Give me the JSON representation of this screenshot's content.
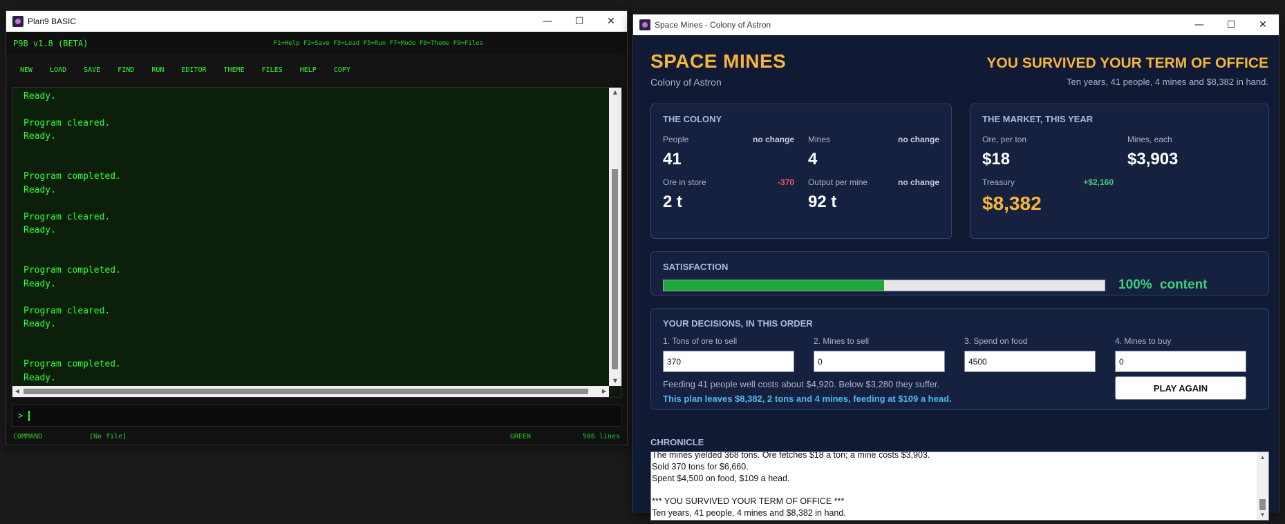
{
  "plan9": {
    "window_title": "Plan9 BASIC",
    "version": "P9B v1.8 (BETA)",
    "key_hints": "F1=Help F2=Save F3=Load F5=Run F7=Mode F8=Theme F9=Files",
    "menu": [
      "NEW",
      "LOAD",
      "SAVE",
      "FIND",
      "RUN",
      "EDITOR",
      "THEME",
      "FILES",
      "HELP",
      "COPY"
    ],
    "output_lines": "Ready.\n\nProgram cleared.\nReady.\n\n\nProgram completed.\nReady.\n\nProgram cleared.\nReady.\n\n\nProgram completed.\nReady.\n\nProgram cleared.\nReady.\n\n\nProgram completed.\nReady.",
    "prompt": ">",
    "status": {
      "mode": "COMMAND",
      "file": "[No file]",
      "theme": "GREEN",
      "lines": "586 lines"
    }
  },
  "spacemines": {
    "window_title": "Space Mines - Colony of Astron",
    "title": "SPACE MINES",
    "subtitle": "Colony of Astron",
    "result_title": "YOU SURVIVED YOUR TERM OF OFFICE",
    "result_sub": "Ten years, 41 people, 4 mines and $8,382 in hand.",
    "colony": {
      "title": "THE COLONY",
      "people": {
        "label": "People",
        "change": "no change",
        "value": "41"
      },
      "mines": {
        "label": "Mines",
        "change": "no change",
        "value": "4"
      },
      "ore": {
        "label": "Ore in store",
        "change": "-370",
        "value": "2 t"
      },
      "output": {
        "label": "Output per mine",
        "change": "no change",
        "value": "92 t"
      }
    },
    "market": {
      "title": "THE MARKET, THIS YEAR",
      "ore_price": {
        "label": "Ore, per ton",
        "value": "$18"
      },
      "mine_price": {
        "label": "Mines, each",
        "value": "$3,903"
      },
      "treasury": {
        "label": "Treasury",
        "change": "+$2,160",
        "value": "$8,382"
      }
    },
    "satisfaction": {
      "title": "SATISFACTION",
      "level": 0.5,
      "percent": "100%",
      "mood": "content"
    },
    "decisions": {
      "title": "YOUR DECISIONS, IN THIS ORDER",
      "ore_to_sell": {
        "label": "1. Tons of ore to sell",
        "value": "370"
      },
      "mines_to_sell": {
        "label": "2. Mines to sell",
        "value": "0"
      },
      "spend_food": {
        "label": "3. Spend on food",
        "value": "4500"
      },
      "mines_to_buy": {
        "label": "4. Mines to buy",
        "value": "0"
      },
      "note": "Feeding 41 people well costs about $4,920. Below $3,280 they suffer.",
      "plan": "This plan leaves $8,382, 2 tons and 4 mines, feeding at $109 a head.",
      "play_again": "PLAY AGAIN"
    },
    "chronicle": {
      "title": "CHRONICLE",
      "text": "The mines yielded 368 tons. Ore fetches $18 a ton; a mine costs $3,903.\nSold 370 tons for $6,660.\nSpent $4,500 on food, $109 a head.\n\n*** YOU SURVIVED YOUR TERM OF OFFICE ***\nTen years, 41 people, 4 mines and $8,382 in hand."
    }
  }
}
